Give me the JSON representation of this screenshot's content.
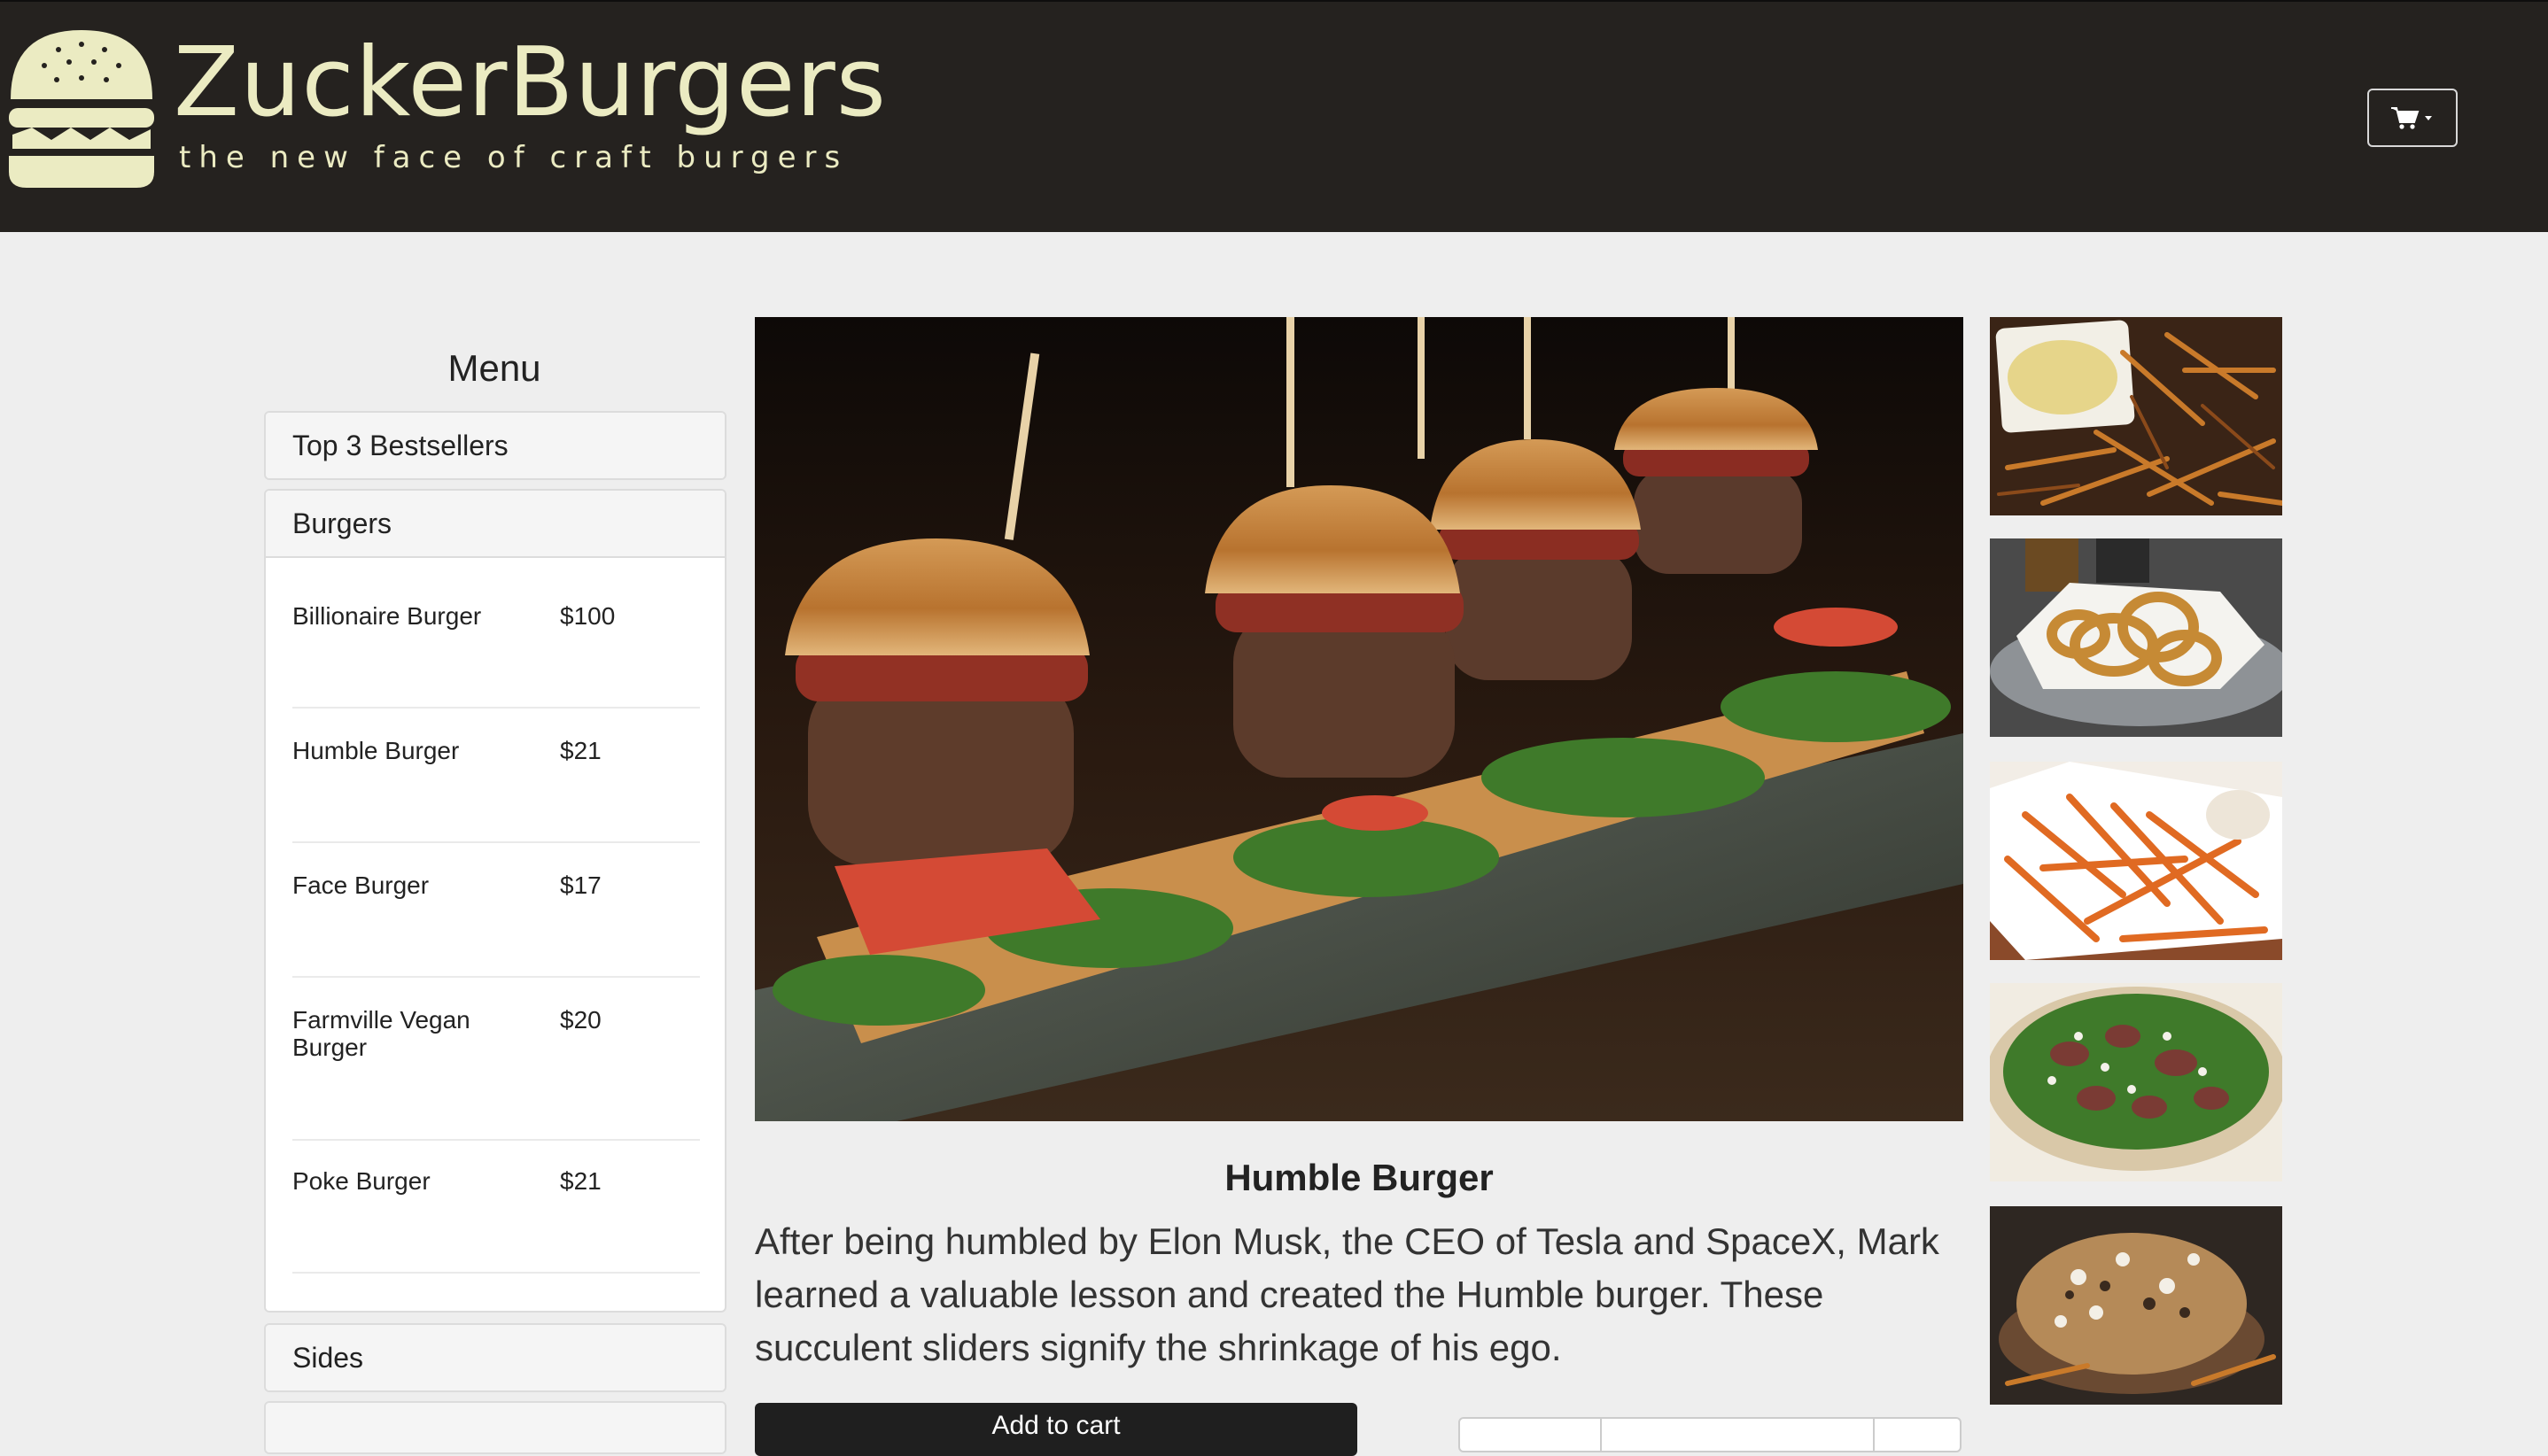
{
  "header": {
    "brand": "ZuckerBurgers",
    "tagline": "the new face of craft burgers",
    "logo_icon": "burger-logo-icon",
    "cart_icon": "shopping-cart-icon"
  },
  "sidebar": {
    "title": "Menu",
    "categories": [
      {
        "label": "Top 3 Bestsellers",
        "open": false
      },
      {
        "label": "Burgers",
        "open": true,
        "items": [
          {
            "name": "Billionaire Burger",
            "price": "$100"
          },
          {
            "name": "Humble Burger",
            "price": "$21"
          },
          {
            "name": "Face Burger",
            "price": "$17"
          },
          {
            "name": "Farmville Vegan Burger",
            "price": "$20"
          },
          {
            "name": "Poke Burger",
            "price": "$21"
          }
        ]
      },
      {
        "label": "Sides",
        "open": false
      }
    ]
  },
  "product": {
    "image": "burger-sliders-photo",
    "title": "Humble Burger",
    "description": "After being humbled by Elon Musk, the CEO of Tesla and SpaceX, Mark learned a valuable lesson and created the Humble burger. These succulent sliders signify the shrinkage of his ego.",
    "add_button_label": "Add to cart"
  },
  "thumbnails": [
    {
      "image": "fries-with-dip-photo"
    },
    {
      "image": "onion-rings-photo"
    },
    {
      "image": "sweet-potato-fries-photo"
    },
    {
      "image": "fig-salad-photo"
    },
    {
      "image": "loaded-fries-photo"
    }
  ],
  "colors": {
    "header_bg": "#25221f",
    "logo_cream": "#ebebc2",
    "page_bg": "#eeeeee",
    "button_dark": "#1f1f1f"
  }
}
